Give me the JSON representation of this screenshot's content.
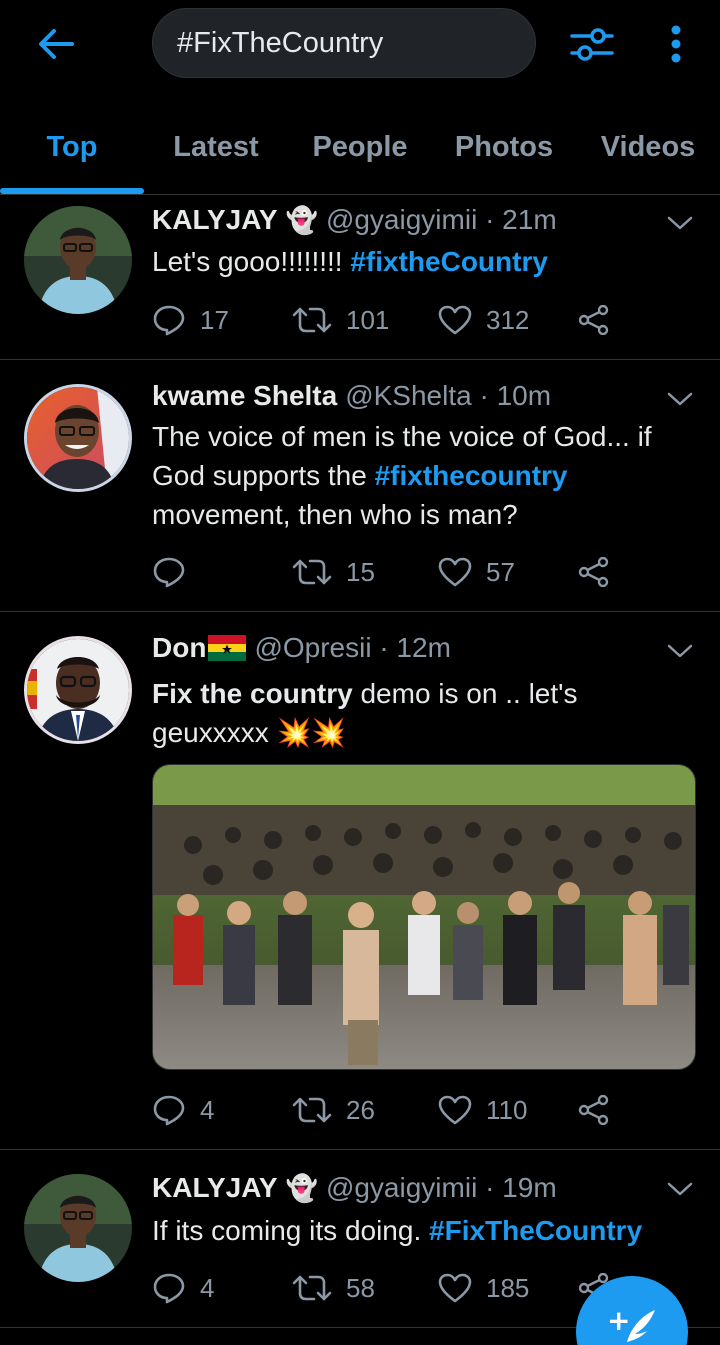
{
  "search": {
    "query": "#FixTheCountry"
  },
  "icons": {
    "back": "arrow-left-icon",
    "filter": "filter-sliders-icon",
    "more": "more-vertical-icon"
  },
  "tabs": [
    {
      "label": "Top",
      "active": true
    },
    {
      "label": "Latest",
      "active": false
    },
    {
      "label": "People",
      "active": false
    },
    {
      "label": "Photos",
      "active": false
    },
    {
      "label": "Videos",
      "active": false
    }
  ],
  "tweets": [
    {
      "name": "KALYJAY",
      "badge": "👻",
      "handle": "@gyaigyimii · 21m",
      "text": "Let's gooo!!!!!!!! ",
      "hashtag": "#fixtheCountry",
      "replies": "17",
      "retweets": "101",
      "likes": "312"
    },
    {
      "name": "kwame Shelta",
      "handle": "@KShelta · 10m",
      "text_1": "The voice of men is the voice of God... if God supports the ",
      "hashtag": "#fixthecountry",
      "text_2": " movement, then who is man?",
      "replies": "",
      "retweets": "15",
      "likes": "57"
    },
    {
      "name": "Don",
      "flag": "ghana-flag",
      "handle": "@Opresii · 12m",
      "bold_text": "Fix the country",
      "text": " demo is on .. let's geuxxxxx ",
      "emoji": "💥💥",
      "media": "crowd-running-photo",
      "replies": "4",
      "retweets": "26",
      "likes": "110"
    },
    {
      "name": "KALYJAY",
      "badge": "👻",
      "handle": "@gyaigyimii · 19m",
      "text": "If its coming its doing. ",
      "hashtag": "#FixTheCountry",
      "replies": "4",
      "retweets": "58",
      "likes": "185"
    }
  ],
  "colors": {
    "accent": "#1d9bf0",
    "background": "#000000",
    "muted": "#8b98a5",
    "divider": "#2f3336"
  },
  "fab": {
    "label": "+",
    "icon": "compose-feather-icon"
  }
}
